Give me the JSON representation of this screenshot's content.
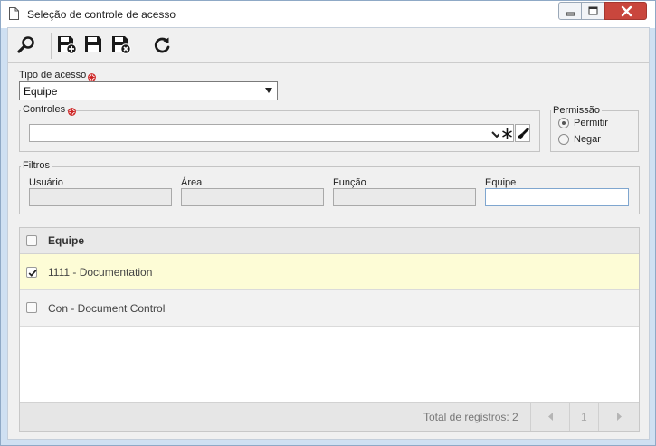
{
  "window": {
    "title": "Seleção de controle de acesso"
  },
  "icons": {
    "title": "document-icon",
    "search": "search-icon",
    "save_new": "save-new-icon",
    "save": "save-icon",
    "save_close": "save-close-icon",
    "refresh": "refresh-icon",
    "required": "required-marker-icon",
    "dropdown": "chevron-down-icon",
    "select_all": "asterisk-icon",
    "clear": "brush-icon"
  },
  "form": {
    "access_type_label": "Tipo de acesso",
    "access_type_value": "Equipe",
    "controls_label": "Controles",
    "controls_value": "",
    "permission_legend": "Permissão",
    "permission_options": [
      "Permitir",
      "Negar"
    ],
    "permission_selected": "Permitir"
  },
  "filters": {
    "legend": "Filtros",
    "fields": [
      {
        "label": "Usuário",
        "value": "",
        "enabled": false
      },
      {
        "label": "Área",
        "value": "",
        "enabled": false
      },
      {
        "label": "Função",
        "value": "",
        "enabled": false
      },
      {
        "label": "Equipe",
        "value": "",
        "enabled": true
      }
    ]
  },
  "grid": {
    "column_header": "Equipe",
    "rows": [
      {
        "text": "1111 - Documentation",
        "checked": true
      },
      {
        "text": "Con - Document Control",
        "checked": false
      }
    ],
    "total_label": "Total de registros: 2",
    "page": "1"
  },
  "colors": {
    "selected_row": "#fdfcd6",
    "required_marker": "#cc2020",
    "close_button": "#c9463d"
  }
}
